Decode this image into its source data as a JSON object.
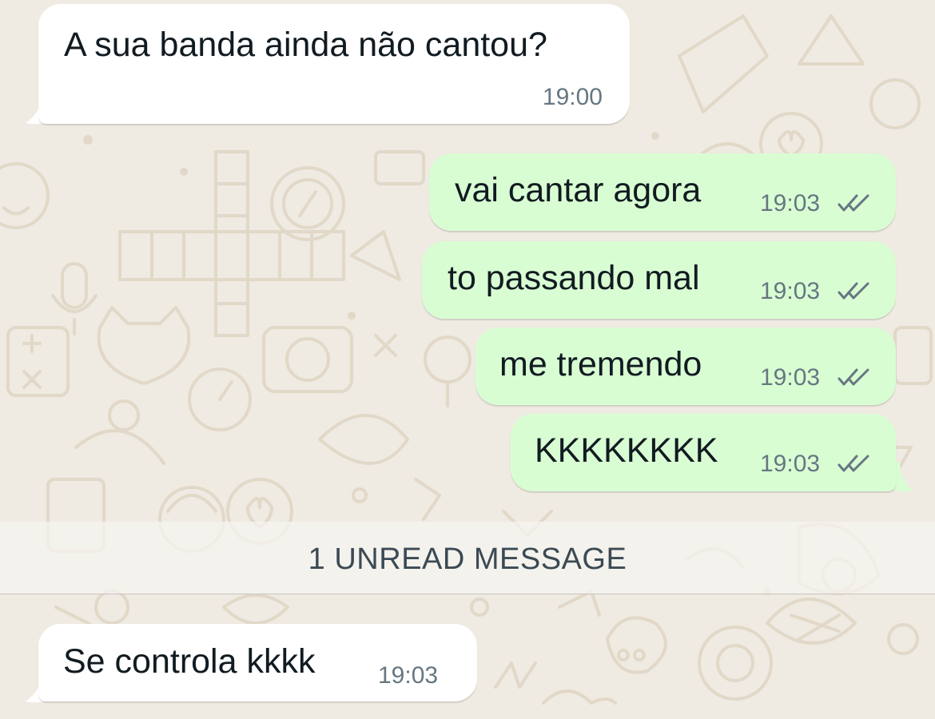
{
  "theme": {
    "wallpaper_bg": "#efeae2",
    "wallpaper_doodle": "#e3d9c9",
    "incoming_bubble": "#ffffff",
    "outgoing_bubble": "#d9fdd3",
    "text": "#111b21",
    "meta_text": "#667781",
    "read_ticks": "#667781"
  },
  "messages": [
    {
      "direction": "incoming",
      "text": "A sua banda ainda não cantou?",
      "time": "19:00"
    },
    {
      "direction": "outgoing",
      "text": "vai cantar agora",
      "time": "19:03",
      "status": "double-check-icon"
    },
    {
      "direction": "outgoing",
      "text": "to passando mal",
      "time": "19:03",
      "status": "double-check-icon"
    },
    {
      "direction": "outgoing",
      "text": "me tremendo",
      "time": "19:03",
      "status": "double-check-icon"
    },
    {
      "direction": "outgoing",
      "text": "KKKKKKKK",
      "time": "19:03",
      "status": "double-check-icon"
    },
    {
      "direction": "incoming",
      "text": "Se controla kkkk",
      "time": "19:03"
    }
  ],
  "unread_divider": {
    "label": "1 UNREAD MESSAGE"
  }
}
